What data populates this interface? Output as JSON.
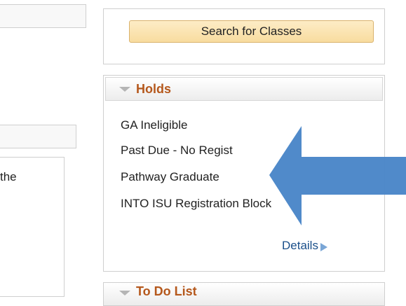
{
  "left": {
    "partial_text": "the"
  },
  "search": {
    "button_label": "Search for Classes"
  },
  "holds": {
    "title": "Holds",
    "items": [
      "GA Ineligible",
      "Past Due - No Regist",
      "Pathway Graduate",
      "INTO ISU Registration Block"
    ],
    "details_label": "Details"
  },
  "todo": {
    "title": "To Do List"
  },
  "colors": {
    "accent_orange": "#b5581c",
    "link_blue": "#1a4f8a",
    "annotation_arrow": "#4a86c8",
    "button_bg": "#fbe3b0"
  },
  "icons": {
    "collapse": "triangle-down-icon",
    "details": "arrow-right-icon",
    "annotation": "annotation-arrow-icon"
  }
}
